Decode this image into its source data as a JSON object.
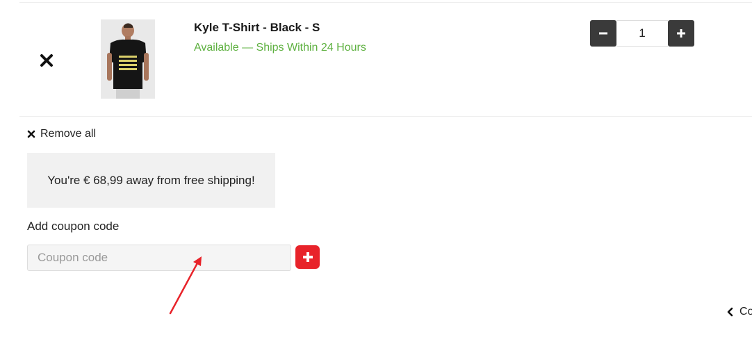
{
  "cart_item": {
    "title": "Kyle T-Shirt - Black - S",
    "status": "Available — Ships Within 24 Hours",
    "quantity": "1",
    "remove_icon": "close-icon",
    "product_image": "black t-shirt back view"
  },
  "cart_actions": {
    "remove_all_label": "Remove all",
    "remove_all_icon": "close-icon"
  },
  "shipping_notice": {
    "text": "You're € 68,99 away from free shipping!"
  },
  "coupon": {
    "label": "Add coupon code",
    "placeholder": "Coupon code",
    "value": "",
    "add_icon": "plus-icon"
  },
  "footer": {
    "continue_label": "Co",
    "continue_icon": "chevron-left-icon"
  },
  "colors": {
    "status_green": "#5db03f",
    "qty_button_bg": "#3a3a3a",
    "coupon_add_bg": "#e8232a",
    "notice_bg": "#f1f1f1",
    "annotation_arrow": "#e8232a"
  }
}
